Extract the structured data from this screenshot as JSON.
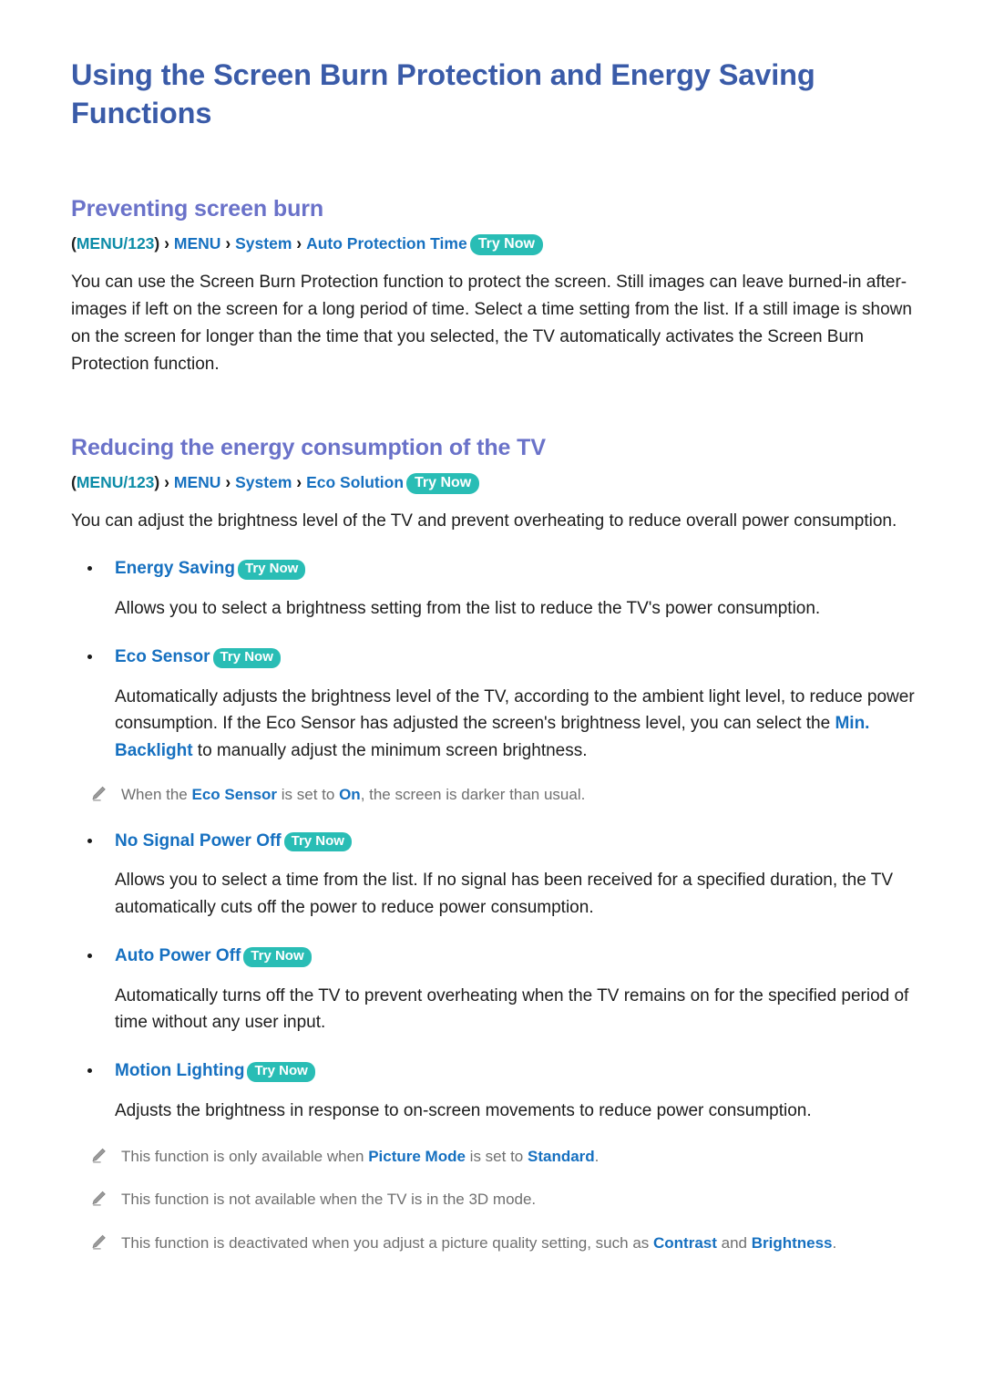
{
  "document": {
    "title": "Using the Screen Burn Protection and Energy Saving Functions"
  },
  "sections": [
    {
      "heading": "Preventing screen burn",
      "menu_path": {
        "open_paren": "(",
        "key": "MENU/123",
        "close_paren": ")",
        "separator": "›",
        "items": [
          "MENU",
          "System",
          "Auto Protection Time"
        ],
        "try_now": "Try Now"
      },
      "body": "You can use the Screen Burn Protection function to protect the screen. Still images can leave burned-in after-images if left on the screen for a long period of time. Select a time setting from the list. If a still image is shown on the screen for longer than the time that you selected, the TV automatically activates the Screen Burn Protection function."
    },
    {
      "heading": "Reducing the energy consumption of the TV",
      "menu_path": {
        "open_paren": "(",
        "key": "MENU/123",
        "close_paren": ")",
        "separator": "›",
        "items": [
          "MENU",
          "System",
          "Eco Solution"
        ],
        "try_now": "Try Now"
      },
      "body": "You can adjust the brightness level of the TV and prevent overheating to reduce overall power consumption."
    }
  ],
  "features": [
    {
      "name": "Energy Saving",
      "try_now": "Try Now",
      "description": "Allows you to select a brightness setting from the list to reduce the TV's power consumption."
    },
    {
      "name": "Eco Sensor",
      "try_now": "Try Now",
      "desc_part1": "Automatically adjusts the brightness level of the TV, according to the ambient light level, to reduce power consumption. If the Eco Sensor has adjusted the screen's brightness level, you can select the ",
      "desc_keyword": "Min. Backlight",
      "desc_part2": " to manually adjust the minimum screen brightness.",
      "note": {
        "part1": "When the ",
        "kw1": "Eco Sensor",
        "part2": " is set to ",
        "kw2": "On",
        "part3": ", the screen is darker than usual."
      }
    },
    {
      "name": "No Signal Power Off",
      "try_now": "Try Now",
      "description": "Allows you to select a time from the list. If no signal has been received for a specified duration, the TV automatically cuts off the power to reduce power consumption."
    },
    {
      "name": "Auto Power Off",
      "try_now": "Try Now",
      "description": "Automatically turns off the TV to prevent overheating when the TV remains on for the specified period of time without any user input."
    },
    {
      "name": "Motion Lighting",
      "try_now": "Try Now",
      "description": "Adjusts the brightness in response to on-screen movements to reduce power consumption."
    }
  ],
  "final_notes": [
    {
      "part1": "This function is only available when ",
      "kw1": "Picture Mode",
      "part2": " is set to ",
      "kw2": "Standard",
      "part3": "."
    },
    {
      "part1": "This function is not available when the TV is in the 3D mode.",
      "kw1": "",
      "part2": "",
      "kw2": "",
      "part3": ""
    },
    {
      "part1": "This function is deactivated when you adjust a picture quality setting, such as ",
      "kw1": "Contrast",
      "part2": " and ",
      "kw2": "Brightness",
      "part3": "."
    }
  ],
  "icons": {
    "note": "pencil-icon",
    "separator": "chevron-right-icon",
    "bullet": "bullet-dot-icon"
  },
  "colors": {
    "title": "#3a5ba8",
    "section_heading": "#6a72c9",
    "menu_key": "#0d8ca8",
    "menu_item": "#1670c0",
    "badge_bg": "#29bdb5",
    "note_text": "#6f6f6f",
    "body_text": "#1c1c1c"
  }
}
